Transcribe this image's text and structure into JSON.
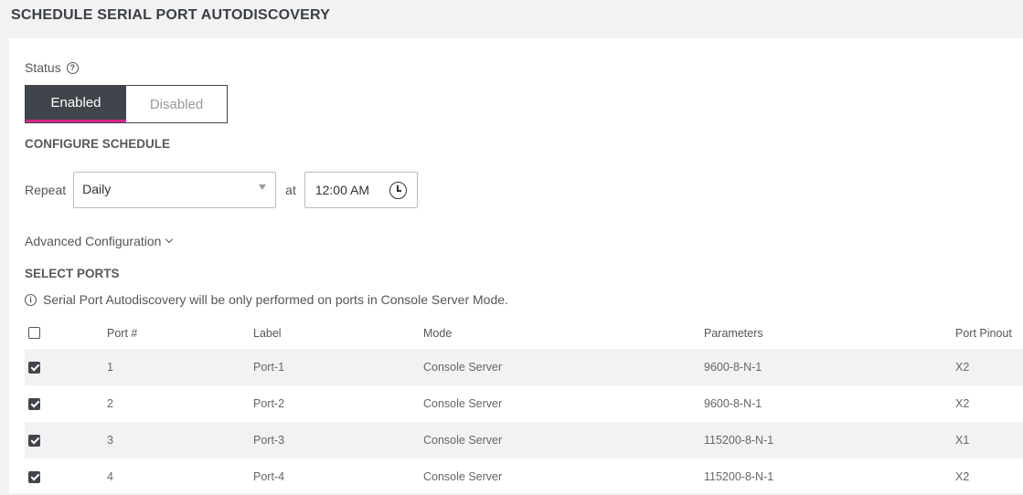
{
  "page_title": "SCHEDULE SERIAL PORT AUTODISCOVERY",
  "status": {
    "label": "Status",
    "help_glyph": "?",
    "options": [
      "Enabled",
      "Disabled"
    ],
    "selected": "Enabled"
  },
  "configure_schedule": {
    "title": "CONFIGURE SCHEDULE",
    "repeat_label": "Repeat",
    "repeat_value": "Daily",
    "at_label": "at",
    "time_value": "12:00 AM"
  },
  "advanced_configuration": "Advanced Configuration",
  "select_ports": {
    "title": "SELECT PORTS",
    "info_glyph": "i",
    "info_text": "Serial Port Autodiscovery will be only performed on ports in Console Server Mode.",
    "columns": [
      "Port #",
      "Label",
      "Mode",
      "Parameters",
      "Port Pinout"
    ],
    "select_all_checked": false,
    "rows": [
      {
        "checked": true,
        "port": "1",
        "label": "Port-1",
        "mode": "Console Server",
        "parameters": "9600-8-N-1",
        "pinout": "X2"
      },
      {
        "checked": true,
        "port": "2",
        "label": "Port-2",
        "mode": "Console Server",
        "parameters": "9600-8-N-1",
        "pinout": "X2"
      },
      {
        "checked": true,
        "port": "3",
        "label": "Port-3",
        "mode": "Console Server",
        "parameters": "115200-8-N-1",
        "pinout": "X1"
      },
      {
        "checked": true,
        "port": "4",
        "label": "Port-4",
        "mode": "Console Server",
        "parameters": "115200-8-N-1",
        "pinout": "X2"
      }
    ]
  },
  "colors": {
    "accent": "#d6248d",
    "toggle_active_bg": "#3f454b",
    "page_bg": "#f2f2f3"
  }
}
